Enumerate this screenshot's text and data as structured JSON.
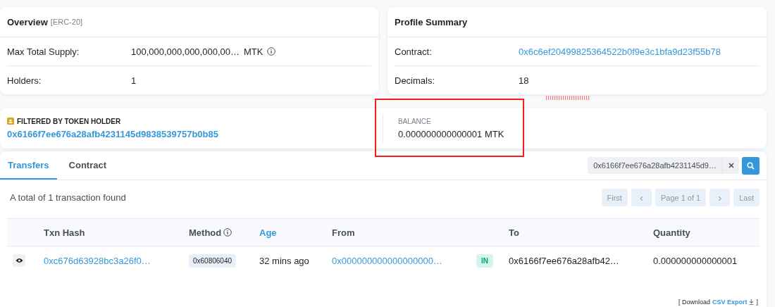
{
  "overview": {
    "title": "Overview",
    "tag": "[ERC-20]",
    "rows": [
      {
        "label": "Max Total Supply:",
        "value": "100,000,000,000,000,00…",
        "unit": "MTK",
        "info": true
      },
      {
        "label": "Holders:",
        "value": "1",
        "info": false
      }
    ]
  },
  "profile": {
    "title": "Profile Summary",
    "rows": [
      {
        "label": "Contract:",
        "value": "0x6c6ef20499825364522b0f9e3c1bfa9d23f55b78",
        "kind": "link"
      },
      {
        "label": "Decimals:",
        "value": "18",
        "kind": "text"
      }
    ]
  },
  "filter": {
    "label": "FILTERED BY TOKEN HOLDER",
    "address": "0x6166f7ee676a28afb4231145d9838539757b0b85",
    "balance_label": "BALANCE",
    "balance": "0.000000000000001 MTK"
  },
  "tabs": [
    {
      "label": "Transfers",
      "selected": true
    },
    {
      "label": "Contract",
      "selected": false
    }
  ],
  "search": {
    "value": "0x6166f7ee676a28afb4231145d9…"
  },
  "summary": "A total of 1 transaction found",
  "pager": [
    {
      "label": "First",
      "kind": "text"
    },
    {
      "label": "‹",
      "kind": "arrow"
    },
    {
      "label": "Page 1 of 1",
      "kind": "text"
    },
    {
      "label": "›",
      "kind": "arrow"
    },
    {
      "label": "Last",
      "kind": "text"
    }
  ],
  "table": {
    "columns": [
      {
        "kind": "blank"
      },
      {
        "label": "Txn Hash",
        "kind": "plain"
      },
      {
        "label": "Method",
        "kind": "info"
      },
      {
        "label": "Age",
        "kind": "sortable"
      },
      {
        "label": "From",
        "kind": "plain"
      },
      {
        "kind": "blank"
      },
      {
        "label": "To",
        "kind": "plain"
      },
      {
        "label": "Quantity",
        "kind": "plain"
      }
    ],
    "rows": [
      {
        "txn_hash": "0xc676d63928bc3a26f0…",
        "method": "0x60806040",
        "age": "32 mins ago",
        "from": "0x000000000000000000…",
        "direction": "IN",
        "to": "0x6166f7ee676a28afb42…",
        "quantity": "0.000000000000001"
      }
    ]
  },
  "download": {
    "prefix": "[ Download",
    "link": "CSV Export",
    "suffix": "]"
  }
}
